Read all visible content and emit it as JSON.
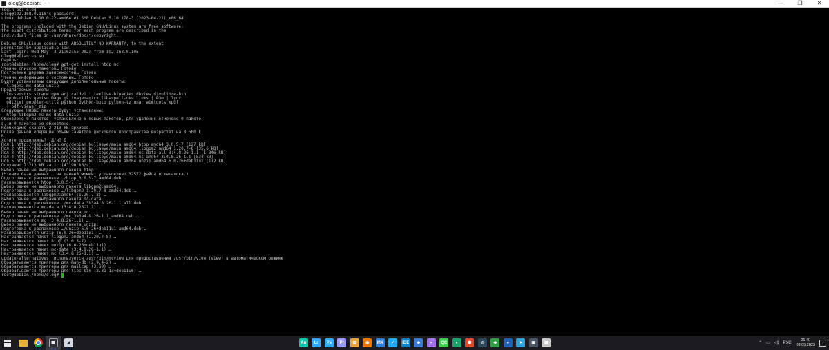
{
  "window": {
    "title": "oleg@debian: ~",
    "minimize": "—",
    "maximize": "❐",
    "close": "✕"
  },
  "terminal": {
    "lines": [
      "login as: oleg",
      "oleg@192.168.0.118's password:",
      "Linux debian 5.10.0-22-amd64 #1 SMP Debian 5.10.178-3 (2023-04-22) x86_64",
      "",
      "The programs included with the Debian GNU/Linux system are free software;",
      "the exact distribution terms for each program are described in the",
      "individual files in /usr/share/doc/*/copyright.",
      "",
      "Debian GNU/Linux comes with ABSOLUTELY NO WARRANTY, to the extent",
      "permitted by applicable law.",
      "Last login: Wed May  3 21:02:55 2023 from 192.168.0.105",
      "oleg@debian:~$ su",
      "Пароль:",
      "root@debian:/home/oleg# apt-get install htop mc",
      "Чтение списков пакетов… Готово",
      "Построение дерева зависимостей… Готово",
      "Чтение информации о состоянии… Готово",
      "Будут установлены следующие дополнительные пакеты:",
      "  libgpm2 mc-data unzip",
      "Предлагаемые пакеты:",
      "  lm-sensors strace gpm arj catdvi | texlive-binaries dbview djvulibre-bin",
      "  epub-utils genisoimage gv imagemagick libaspell-dev links | w3m | lynx",
      "  odt2txt poppler-utils python python-boto python-tz unar wimtools xpdf",
      "  | pdf-viewer zip",
      "Следующие НОВЫЕ пакеты будут установлены:",
      "  htop libgpm2 mc mc-data unzip",
      "Обновлено 0 пакетов, установлено 5 новых пакетов, для удаления отмечено 0 пакето",
      "в, и 0 пакетов не обновлено.",
      "Необходимо скачать 2 213 kB архивов.",
      "После данной операции объём занятого дискового пространства возрастёт на 8 560 k",
      "B.",
      "Хотите продолжить? [Д/н] Д",
      "Пол:1 http://deb.debian.org/debian bullseye/main amd64 htop amd64 3.0.5-7 [127 kB]",
      "Пол:2 http://deb.debian.org/debian bullseye/main amd64 libgpm2 amd64 1.20.7-8 [35,6 kB]",
      "Пол:3 http://deb.debian.org/debian bullseye/main amd64 mc-data all 3:4.8.26-1.1 [1 346 kB]",
      "Пол:4 http://deb.debian.org/debian bullseye/main amd64 mc amd64 3:4.8.26-1.1 [534 kB]",
      "Пол:5 http://deb.debian.org/debian bullseye/main amd64 unzip amd64 6.0-26+deb11u1 [172 kB]",
      "Получено 2 213 kB за 1с (4 190 kB/s)",
      "Выбор ранее не выбранного пакета htop.",
      "(Чтение базы данных … на данный момент установлено 32572 файла и каталога.)",
      "Подготовка к распаковке …/htop_3.0.5-7_amd64.deb …",
      "Распаковывается htop (3.0.5-7) …",
      "Выбор ранее не выбранного пакета libgpm2:amd64.",
      "Подготовка к распаковке …/libgpm2_1.20.7-8_amd64.deb …",
      "Распаковывается libgpm2:amd64 (1.20.7-8) …",
      "Выбор ранее не выбранного пакета mc-data.",
      "Подготовка к распаковке …/mc-data_3%3a4.8.26-1.1_all.deb …",
      "Распаковывается mc-data (3:4.8.26-1.1) …",
      "Выбор ранее не выбранного пакета mc.",
      "Подготовка к распаковке …/mc_3%3a4.8.26-1.1_amd64.deb …",
      "Распаковывается mc (3:4.8.26-1.1) …",
      "Выбор ранее не выбранного пакета unzip.",
      "Подготовка к распаковке …/unzip_6.0-26+deb11u1_amd64.deb …",
      "Распаковывается unzip (6.0-26+deb11u1) …",
      "Настраивается пакет libgpm2:amd64 (1.20.7-8) …",
      "Настраивается пакет htop (3.0.5-7) …",
      "Настраивается пакет unzip (6.0-26+deb11u1) …",
      "Настраивается пакет mc-data (3:4.8.26-1.1) …",
      "Настраивается пакет mc (3:4.8.26-1.1) …",
      "update-alternatives: используется /usr/bin/mcview для предоставления /usr/bin/view (view) в автоматическом режиме",
      "Обрабатываются триггеры для man-db (2.9.4-2) …",
      "Обрабатываются триггеры для mailcap (3.69) …",
      "Обрабатываются триггеры для libc-bin (2.31-13+deb11u6) …"
    ],
    "prompt": "root@debian:/home/oleg# "
  },
  "taskbar": {
    "pinned_icons": [
      {
        "name": "audition-icon",
        "label": "Au",
        "color": "#00c8a8"
      },
      {
        "name": "lightroom-icon",
        "label": "Lr",
        "color": "#31a8ff"
      },
      {
        "name": "photoshop-icon",
        "label": "Ps",
        "color": "#31a8ff"
      },
      {
        "name": "premiere-icon",
        "label": "Pr",
        "color": "#9999ff"
      },
      {
        "name": "folder-app-icon",
        "label": "▤",
        "color": "#e8a33d"
      },
      {
        "name": "blender-icon",
        "label": "◉",
        "color": "#ea7600"
      },
      {
        "name": "mx-icon",
        "label": "MX",
        "color": "#2f7fd8"
      },
      {
        "name": "visual-studio-code-icon",
        "label": "✓",
        "color": "#23a9f2"
      },
      {
        "name": "ide-icon",
        "label": "IDE",
        "color": "#0a84c6"
      },
      {
        "name": "database-icon",
        "label": "◈",
        "color": "#3a7bd5"
      },
      {
        "name": "visual-studio-icon",
        "label": "∞",
        "color": "#a074e8"
      },
      {
        "name": "qt-creator-icon",
        "label": "QC",
        "color": "#41cd52"
      },
      {
        "name": "vpn-icon",
        "label": "◐",
        "color": "#1aa36b"
      },
      {
        "name": "shield-icon",
        "label": "⬢",
        "color": "#e04b2f"
      },
      {
        "name": "steam-icon",
        "label": "◎",
        "color": "#2a475e"
      },
      {
        "name": "network-app-icon",
        "label": "◆",
        "color": "#2f9e44"
      },
      {
        "name": "app-b-icon",
        "label": "●",
        "color": "#1e5fb8"
      },
      {
        "name": "telegram-icon",
        "label": "➤",
        "color": "#2aa3df"
      },
      {
        "name": "monitor-app-icon",
        "label": "▣",
        "color": "#4a5568"
      },
      {
        "name": "putty-icon",
        "label": "▦",
        "color": "#c8c8c8"
      }
    ],
    "tray": {
      "chevron": "⌃",
      "language": "РУС",
      "time": "21:40",
      "date": "03.05.2023"
    }
  }
}
